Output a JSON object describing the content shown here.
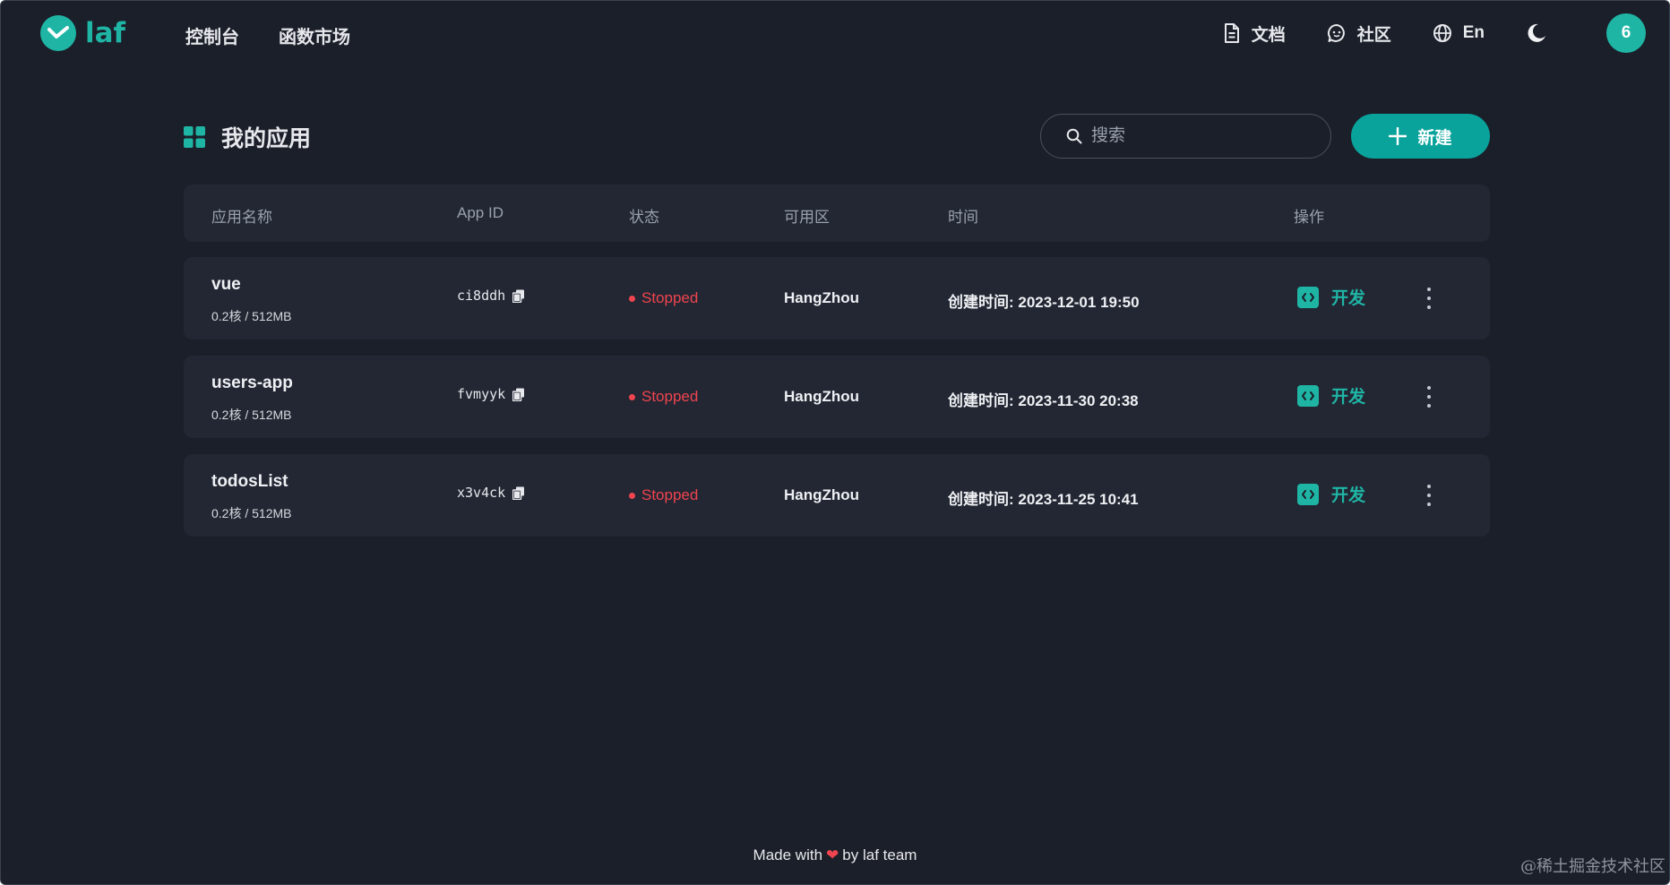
{
  "header": {
    "logo_text": "laf",
    "nav": [
      "控制台",
      "函数市场"
    ],
    "docs_label": "文档",
    "community_label": "社区",
    "lang_label": "En",
    "avatar_text": "6"
  },
  "page": {
    "title": "我的应用",
    "search_placeholder": "搜索",
    "new_button_label": "新建"
  },
  "table": {
    "columns": [
      "应用名称",
      "App ID",
      "状态",
      "可用区",
      "时间",
      "操作"
    ],
    "rows": [
      {
        "name": "vue",
        "spec": "0.2核 / 512MB",
        "app_id": "ci8ddh",
        "status": "Stopped",
        "zone": "HangZhou",
        "created": "创建时间: 2023-12-01 19:50",
        "action": "开发"
      },
      {
        "name": "users-app",
        "spec": "0.2核 / 512MB",
        "app_id": "fvmyyk",
        "status": "Stopped",
        "zone": "HangZhou",
        "created": "创建时间: 2023-11-30 20:38",
        "action": "开发"
      },
      {
        "name": "todosList",
        "spec": "0.2核 / 512MB",
        "app_id": "x3v4ck",
        "status": "Stopped",
        "zone": "HangZhou",
        "created": "创建时间: 2023-11-25 10:41",
        "action": "开发"
      }
    ]
  },
  "footer": {
    "made_with": "Made with",
    "by_text": "by laf team"
  },
  "watermark": "@稀土掘金技术社区",
  "colors": {
    "accent": "#1fb5a5",
    "primary_button": "#0aa39c",
    "status_stopped": "#f0444f",
    "background": "#1b1f29",
    "row_background": "#222733"
  },
  "icons": [
    "laf-logo-icon",
    "document-icon",
    "chat-icon",
    "globe-icon",
    "moon-icon",
    "apps-grid-icon",
    "search-icon",
    "plus-icon",
    "copy-icon",
    "code-icon",
    "more-vertical-icon",
    "heart-icon"
  ]
}
